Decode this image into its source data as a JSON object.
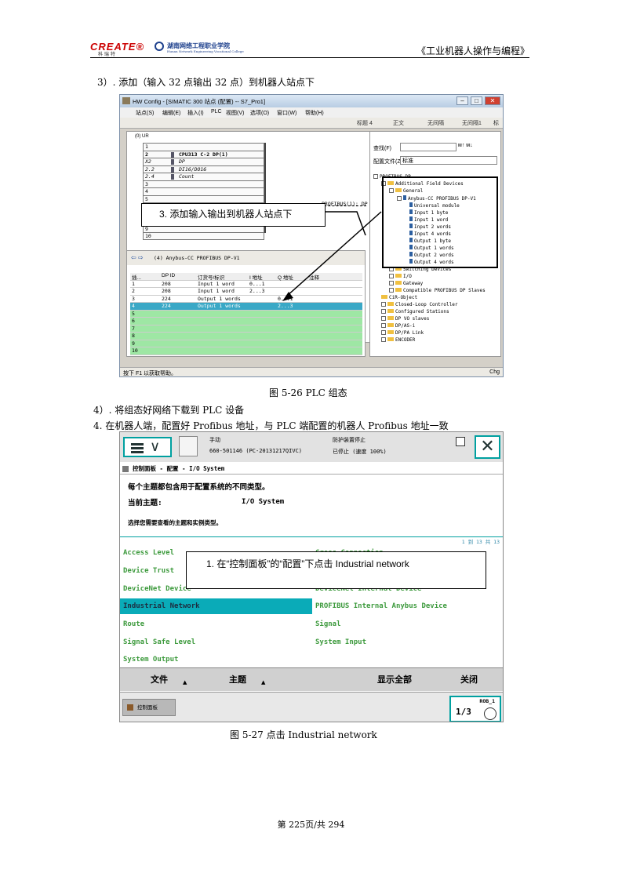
{
  "header": {
    "logo_brand": "CREATE®",
    "logo_brand_sub": "科 瑞 特",
    "logo_school": "湖南网络工程职业学院",
    "logo_school_sub": "Hunan Network Engineering Vocational College",
    "title": "《工业机器人操作与编程》"
  },
  "step3": "3）. 添加（输入 32 点输出 32 点）到机器人站点下",
  "figure1": {
    "window_title": "HW Config - [SIMATIC 300 站点 (配置) -- S7_Pro1]",
    "win_min": "–",
    "win_max": "□",
    "win_close": "✕",
    "menus": [
      "站点(S)",
      "编辑(E)",
      "插入(I)",
      "PLC",
      "视图(V)",
      "选项(O)",
      "窗口(W)",
      "帮助(H)"
    ],
    "toolbar_items": [
      "标题 4",
      "正文",
      "无间隔",
      "无间隔1",
      "标"
    ],
    "rack_title": "(0) UR",
    "rack_rows": [
      {
        "slot": "1",
        "module": ""
      },
      {
        "slot": "2",
        "module": "CPU313 C-2 DP(1)"
      },
      {
        "slot": "X2",
        "module": "DP"
      },
      {
        "slot": "2.2",
        "module": "DI16/DO16"
      },
      {
        "slot": "2.4",
        "module": "Count"
      },
      {
        "slot": "3",
        "module": ""
      },
      {
        "slot": "4",
        "module": ""
      },
      {
        "slot": "5",
        "module": ""
      },
      {
        "slot": "6",
        "module": ""
      },
      {
        "slot": "7",
        "module": ""
      },
      {
        "slot": "8",
        "module": ""
      },
      {
        "slot": "9",
        "module": ""
      },
      {
        "slot": "10",
        "module": ""
      }
    ],
    "bus_label": "PROFIBUS(1): DP",
    "detail_arrows": "⇦ ⇨",
    "detail_title": "(4)    Anybus-CC PROFIBUS DP-V1",
    "detail_headers": [
      "插...",
      "DP ID",
      "订货号/标识",
      "I 地址",
      "Q 地址",
      "注释"
    ],
    "detail_rows": [
      {
        "slot": "1",
        "id": "208",
        "name": "Input 1 word",
        "i": "0...1",
        "q": ""
      },
      {
        "slot": "2",
        "id": "208",
        "name": "Input 1 word",
        "i": "2...3",
        "q": ""
      },
      {
        "slot": "3",
        "id": "224",
        "name": "Output 1 words",
        "i": "",
        "q": "0...1"
      },
      {
        "slot": "4",
        "id": "224",
        "name": "Output 1 words",
        "i": "",
        "q": "2...3"
      },
      {
        "slot": "5",
        "id": "",
        "name": "",
        "i": "",
        "q": ""
      },
      {
        "slot": "6",
        "id": "",
        "name": "",
        "i": "",
        "q": ""
      },
      {
        "slot": "7",
        "id": "",
        "name": "",
        "i": "",
        "q": ""
      },
      {
        "slot": "8",
        "id": "",
        "name": "",
        "i": "",
        "q": ""
      },
      {
        "slot": "9",
        "id": "",
        "name": "",
        "i": "",
        "q": ""
      },
      {
        "slot": "10",
        "id": "",
        "name": "",
        "i": "",
        "q": ""
      }
    ],
    "catalog_find_label": "查找(F)",
    "catalog_find_buttons": "ᴍ↑  ᴍ↓",
    "catalog_profile_label": "配置文件(Z)",
    "catalog_profile_value": "标准",
    "catalog_tree": [
      "PROFIBUS DP",
      "Additional Field Devices",
      "General",
      "Anybus-CC PROFIBUS DP-V1",
      "Universal module",
      "Input 1 byte",
      "Input 1 word",
      "Input 2 words",
      "Input 4 words",
      "Output 1 byte",
      "Output 1 words",
      "Output 2 words",
      "Output 4 words",
      "Switching Devices",
      "I/O",
      "Gateway",
      "Compatible PROFIBUS DP Slaves",
      "CiR-Object",
      "Closed-Loop Controller",
      "Configured Stations",
      "DP VO slaves",
      "DP/AS-i",
      "DP/PA Link",
      "ENCODER"
    ],
    "status_text": "按下 F1 以获取帮助。",
    "status_right": "Chg",
    "callout": "3. 添加输入输出到机器人站点下"
  },
  "caption1": "图 5-26 PLC 组态",
  "step4a": "4）. 将组态好网络下载到 PLC 设备",
  "step4b": "4. 在机器人端，配置好 Profibus 地址，与 PLC 端配置的机器人 Profibus 地址一致",
  "figure2": {
    "mode": "手动",
    "serial": "660-501146 (PC-20131217QIVC)",
    "safety": "防护装置停止",
    "speed": "已停止 (速度 100%)",
    "close_glyph": "✕",
    "menu_chevron": "∨",
    "breadcrumb": "控制面板 - 配置 - I/O System",
    "description": "每个主题都包含用于配置系统的不同类型。",
    "topic_label": "当前主题:",
    "topic_value": "I/O System",
    "select_text": "选择您需要查看的主题和实例类型。",
    "count": "1 到 13 共 13",
    "items_left": [
      "Access Level",
      "Device Trust",
      "DeviceNet Device",
      "Industrial Network",
      "Route",
      "Signal Safe Level",
      "System Output"
    ],
    "items_right": [
      "Cross Connection",
      "",
      "DeviceNet Internal Device",
      "PROFIBUS Internal Anybus Device",
      "Signal",
      "System Input"
    ],
    "bottom_file": "文件",
    "bottom_topic": "主题",
    "bottom_show_all": "显示全部",
    "bottom_close": "关闭",
    "taskbar_button": "控制面板",
    "rob_label": "ROB_1",
    "rob_fraction": "1/3",
    "callout": "1. 在“控制面板”的“配置”下点击 Industrial network"
  },
  "caption2": "图 5-27 点击 Industrial network",
  "page_number": "第 225页/共 294"
}
